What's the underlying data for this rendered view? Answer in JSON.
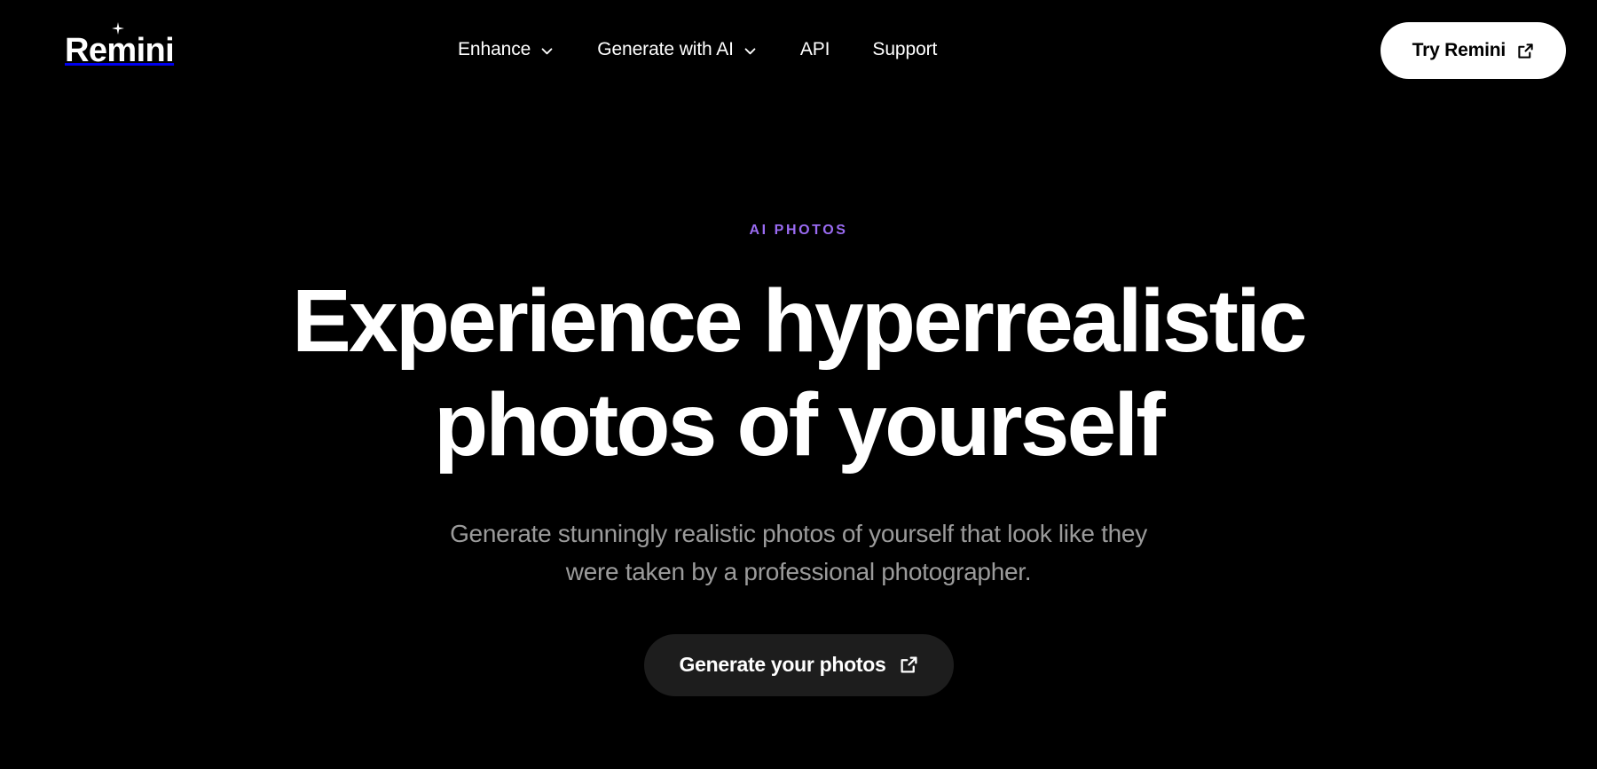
{
  "theme": {
    "background": "#000000",
    "accent_purple": "#9a6bf2",
    "text_primary": "#ffffff",
    "text_muted": "#9b9b9b",
    "pill_light": "#ffffff",
    "pill_dark": "#1d1d1d"
  },
  "navbar": {
    "brand": {
      "name": "Remini",
      "sparkle_icon": "sparkle-icon"
    },
    "links": [
      {
        "label": "Enhance",
        "has_dropdown": true,
        "icon": "chevron-down-icon"
      },
      {
        "label": "Generate with AI",
        "has_dropdown": true,
        "icon": "chevron-down-icon"
      },
      {
        "label": "API",
        "has_dropdown": false,
        "icon": ""
      },
      {
        "label": "Support",
        "has_dropdown": false,
        "icon": ""
      }
    ],
    "cta": {
      "label": "Try Remini",
      "icon": "external-link-icon"
    }
  },
  "hero": {
    "eyebrow": "AI PHOTOS",
    "headline_line1": "Experience hyperrealistic",
    "headline_line2": "photos of yourself",
    "subhead_line1": "Generate stunningly realistic photos of yourself that look like they",
    "subhead_line2": "were taken by a professional photographer.",
    "cta": {
      "label": "Generate your photos",
      "icon": "external-link-icon"
    }
  }
}
